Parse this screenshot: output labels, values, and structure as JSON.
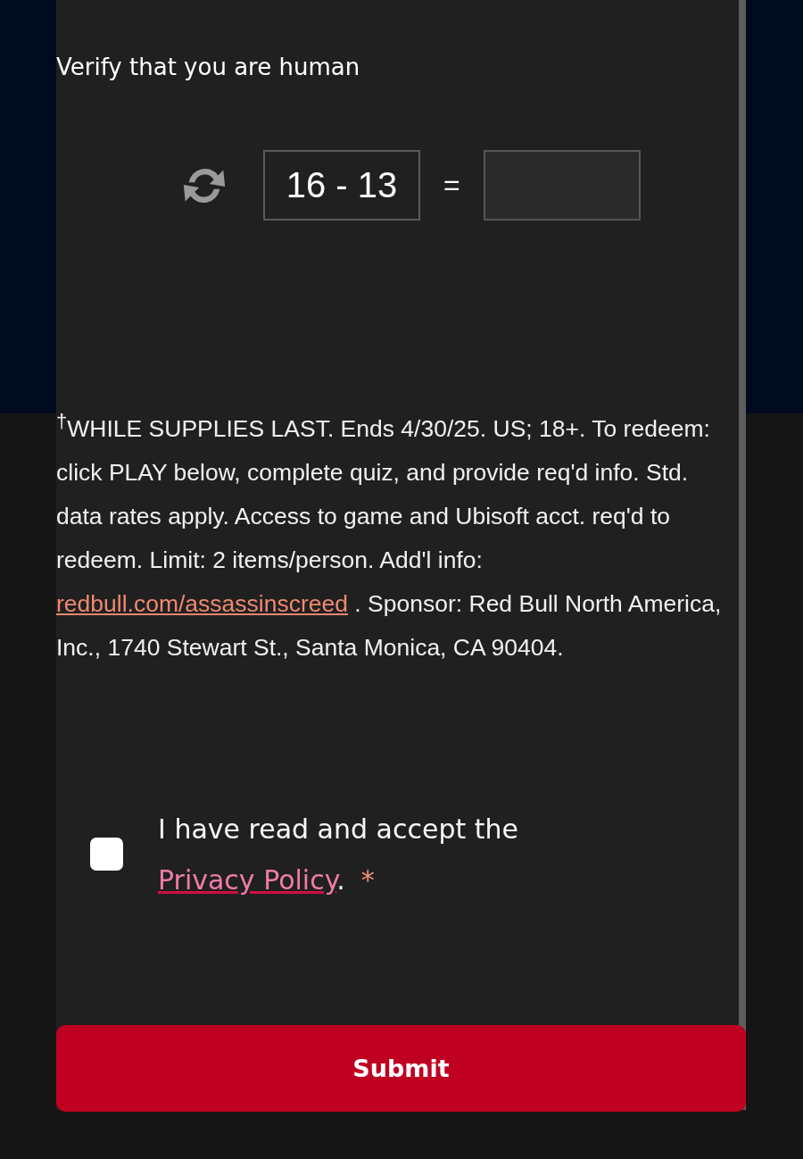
{
  "title": "Verify that you are human",
  "captcha": {
    "question": "16 - 13",
    "operator": "="
  },
  "terms": {
    "before": "$^{†}$WHILE SUPPLIES LAST. Ends 4/30/25. US; 18+. To redeem: click PLAY below, complete quiz, and provide req'd info. Std. data rates apply. Access to game and Ubisoft acct. req'd to redeem. Limit: 2 items/person. Add'l info: ",
    "link": "redbull.com/assassinscreed",
    "after": " . Sponsor: Red Bull North America, Inc., 1740 Stewart St., Santa Monica, CA 90404."
  },
  "consent": {
    "checked": false,
    "text": "I have read and accept the ",
    "link": "Privacy Policy",
    "after": ".",
    "required_mark": "*"
  },
  "submit": "Submit"
}
